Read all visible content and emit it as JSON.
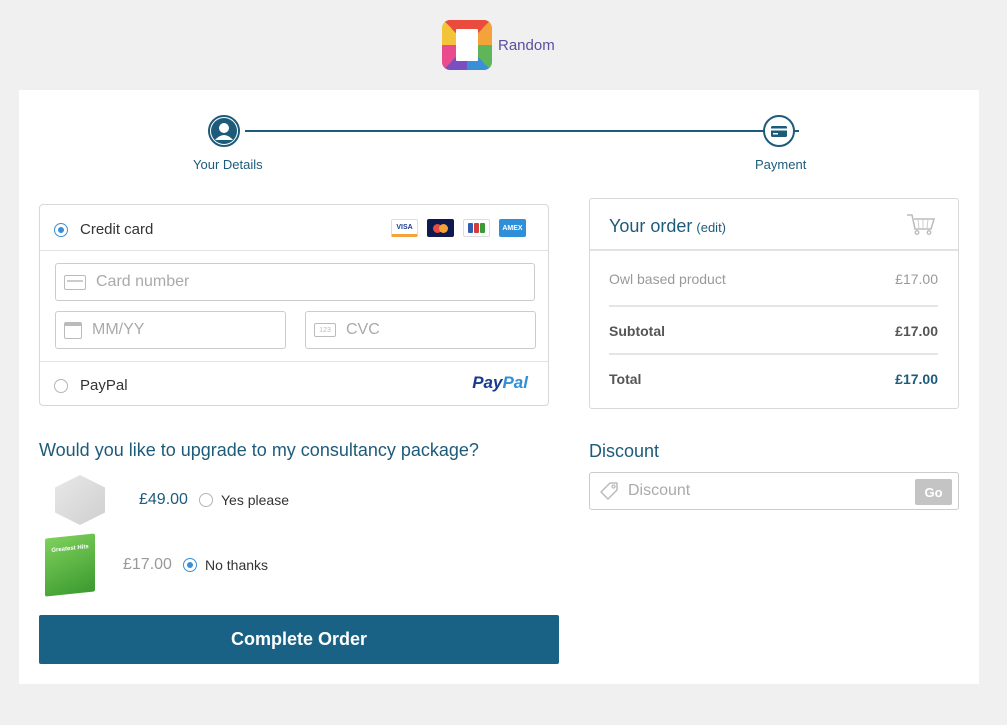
{
  "brand": {
    "name": "Random"
  },
  "steps": [
    {
      "label": "Your Details"
    },
    {
      "label": "Payment"
    }
  ],
  "payment": {
    "credit_card_label": "Credit card",
    "card_brands": [
      "VISA",
      "Mastercard",
      "JCB",
      "AMEX"
    ],
    "card_number_placeholder": "Card number",
    "expiry_placeholder": "MM/YY",
    "cvc_placeholder": "CVC",
    "cvc_icon_text": "123",
    "paypal_label": "PayPal",
    "paypal_logo_part1": "Pay",
    "paypal_logo_part2": "Pal",
    "selected": "credit_card"
  },
  "upgrade": {
    "question": "Would you like to upgrade to my consultancy package?",
    "options": [
      {
        "price": "£49.00",
        "label": "Yes please",
        "selected": false
      },
      {
        "price": "£17.00",
        "label": "No thanks",
        "selected": true
      }
    ],
    "green_box_text": "Greatest Hits"
  },
  "complete_button": "Complete Order",
  "order": {
    "title": "Your order",
    "edit_label": "(edit)",
    "items": [
      {
        "name": "Owl based product",
        "price": "£17.00"
      }
    ],
    "subtotal_label": "Subtotal",
    "subtotal": "£17.00",
    "total_label": "Total",
    "total": "£17.00"
  },
  "discount": {
    "title": "Discount",
    "placeholder": "Discount",
    "go_label": "Go"
  },
  "colors": {
    "accent": "#1d5b7a",
    "button": "#1a6285",
    "radio": "#3a8fd6",
    "brand_text": "#5a4fa0"
  }
}
